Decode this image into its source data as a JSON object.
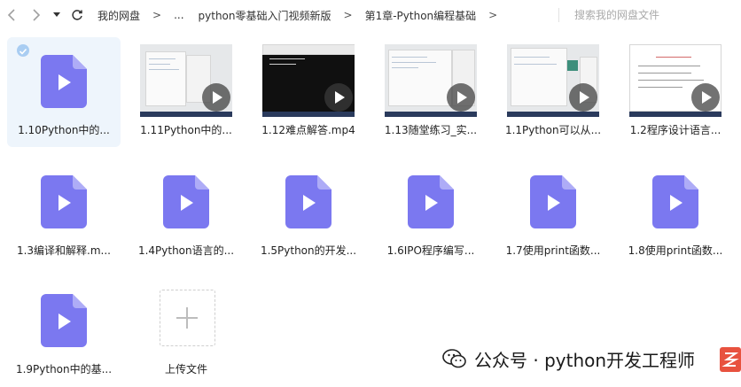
{
  "nav": {
    "back_icon": "chevron-left-icon",
    "forward_icon": "chevron-right-icon",
    "dropdown_icon": "caret-down-icon",
    "refresh_icon": "refresh-icon"
  },
  "breadcrumb": {
    "items": [
      "我的网盘",
      "...",
      "python零基础入门视频新版",
      "第1章-Python编程基础"
    ],
    "separator": ">"
  },
  "search": {
    "placeholder": "搜索我的网盘文件",
    "value": ""
  },
  "files": [
    {
      "name": "1.10Python中的...",
      "kind": "video-doc",
      "selected": true
    },
    {
      "name": "1.11Python中的...",
      "kind": "video-thumb"
    },
    {
      "name": "1.12难点解答.mp4",
      "kind": "video-thumb"
    },
    {
      "name": "1.13随堂练习_实...",
      "kind": "video-thumb"
    },
    {
      "name": "1.1Python可以从...",
      "kind": "video-thumb"
    },
    {
      "name": "1.2程序设计语言...",
      "kind": "video-thumb"
    },
    {
      "name": "1.3编译和解释.m...",
      "kind": "video-doc"
    },
    {
      "name": "1.4Python语言的...",
      "kind": "video-doc"
    },
    {
      "name": "1.5Python的开发...",
      "kind": "video-doc"
    },
    {
      "name": "1.6IPO程序编写...",
      "kind": "video-doc"
    },
    {
      "name": "1.7使用print函数...",
      "kind": "video-doc"
    },
    {
      "name": "1.8使用print函数...",
      "kind": "video-doc"
    },
    {
      "name": "1.9Python中的基...",
      "kind": "video-doc"
    }
  ],
  "upload": {
    "label": "上传文件",
    "icon": "plus-icon"
  },
  "watermark": {
    "text": "公众号 · python开发工程师",
    "icon": "wechat-icon"
  },
  "colors": {
    "accent": "#7b78f0",
    "selected_bg": "#eef5fc",
    "check": "#a9cdf2"
  }
}
